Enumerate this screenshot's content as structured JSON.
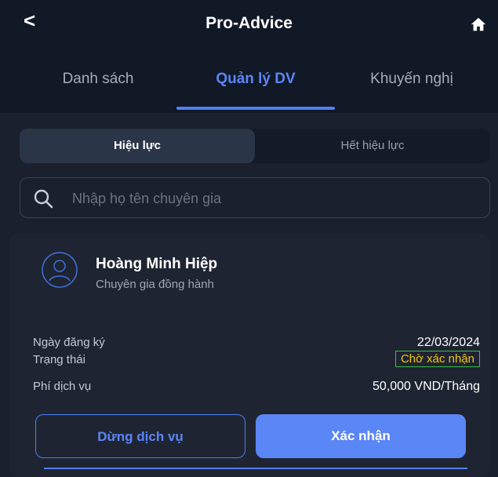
{
  "header": {
    "back_symbol": "<",
    "title": "Pro-Advice",
    "home_icon": "home-icon"
  },
  "tabs": [
    {
      "label": "Danh sách",
      "active": false
    },
    {
      "label": "Quản lý DV",
      "active": true
    },
    {
      "label": "Khuyến nghị",
      "active": false
    }
  ],
  "segment": {
    "active_label": "Hiệu lực",
    "inactive_label": "Hết hiệu lực"
  },
  "search": {
    "placeholder": "Nhập họ tên chuyên gia",
    "icon": "search-icon"
  },
  "card": {
    "expert_name": "Hoàng Minh Hiệp",
    "expert_role": "Chuyên gia đồng hành",
    "rows": [
      {
        "label": "Ngày đăng ký",
        "value": "22/03/2024"
      },
      {
        "label": "Trạng thái",
        "value": "Chờ xác nhận"
      },
      {
        "label": "Phí dịch vụ",
        "value": "50,000 VND/Tháng"
      }
    ],
    "stop_button": "Dừng dịch vụ",
    "confirm_button": "Xác nhận"
  },
  "colors": {
    "accent": "#5b86f6",
    "status": "#f0c419",
    "background": "#111826"
  }
}
